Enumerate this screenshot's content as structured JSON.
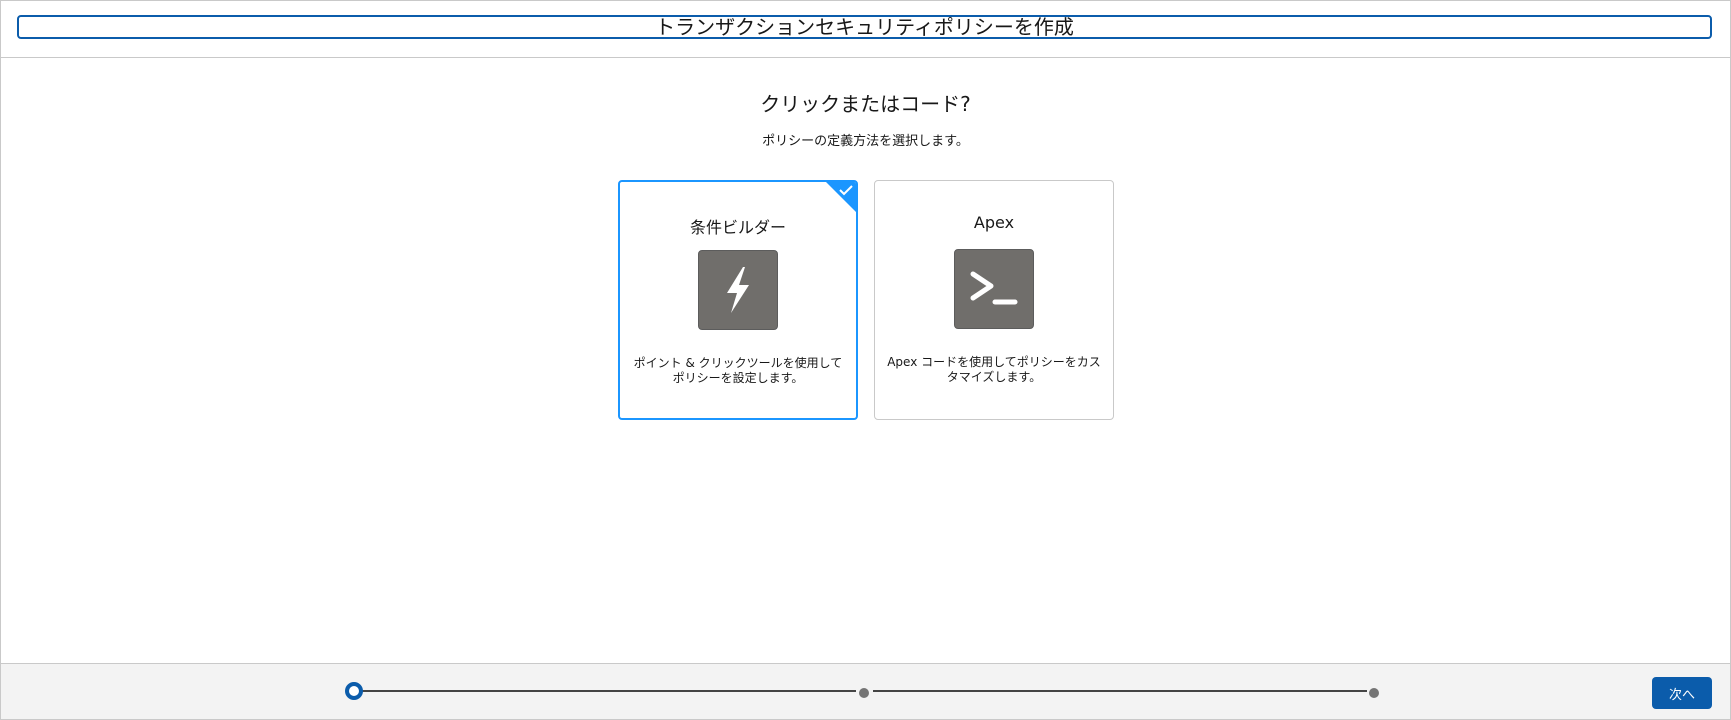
{
  "header": {
    "title": "トランザクションセキュリティポリシーを作成"
  },
  "content": {
    "heading": "クリックまたはコード?",
    "subheading": "ポリシーの定義方法を選択します。"
  },
  "options": [
    {
      "title": "条件ビルダー",
      "icon": "lightning-bolt-icon",
      "description": "ポイント & クリックツールを使用してポリシーを設定します。",
      "selected": true
    },
    {
      "title": "Apex",
      "icon": "terminal-prompt-icon",
      "description": "Apex コードを使用してポリシーをカスタマイズします。",
      "selected": false
    }
  ],
  "footer": {
    "steps": 3,
    "current_step": 1,
    "next_label": "次へ"
  },
  "colors": {
    "brand": "#0b5cab",
    "selected_border": "#1b96ff",
    "icon_bg": "#706e6b",
    "footer_bg": "#f3f3f3"
  }
}
